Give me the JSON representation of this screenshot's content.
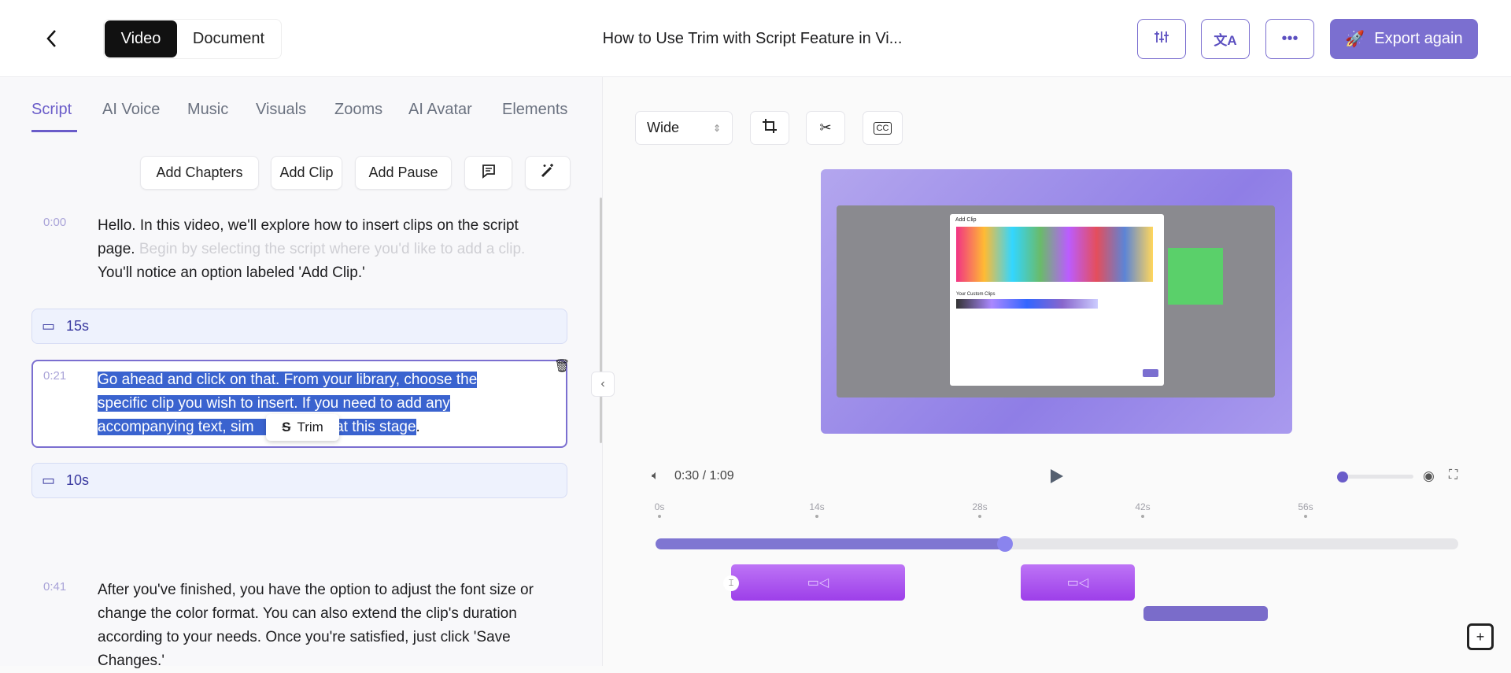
{
  "header": {
    "title": "How to Use Trim with Script Feature in Vi...",
    "mode_tabs": [
      "Video",
      "Document"
    ],
    "active_mode": "Video",
    "export_label": "Export again"
  },
  "tabs": [
    "Script",
    "AI Voice",
    "Music",
    "Visuals",
    "Zooms",
    "AI Avatar",
    "Elements"
  ],
  "active_tab": "Script",
  "actions": {
    "add_chapters": "Add Chapters",
    "add_clip": "Add Clip",
    "add_pause": "Add Pause"
  },
  "script": [
    {
      "time": "0:00",
      "text_a": "Hello. In this video, we'll explore how to insert clips on the script page.",
      "text_faded": "Begin by selecting the script where you'd like to add a clip.",
      "text_b": "You'll notice an option labeled 'Add Clip.'"
    },
    {
      "clip": "15s"
    },
    {
      "time": "0:21",
      "line1": "Go ahead and click on that. From your library, choose the",
      "line2": "specific clip you wish to insert. If you need to add any",
      "line3a": "accompanying text, sim",
      "line3b": "t at this stage",
      "line3c": "."
    },
    {
      "clip": "10s"
    },
    {
      "time": "0:41",
      "text": "After you've finished, you have the option to adjust the font size or change the color format. You can also extend the clip's duration according to your needs. Once you're satisfied, just click 'Save Changes.'"
    }
  ],
  "trim_popup": "Trim",
  "player": {
    "aspect": "Wide",
    "time": "0:30 / 1:09",
    "progress": 0.435,
    "ticks": [
      "0s",
      "14s",
      "28s",
      "42s",
      "56s"
    ]
  },
  "preview": {
    "dialog_title": "Add Clip",
    "custom_clips": "Your Custom Clips"
  },
  "colors": {
    "accent": "#7b6fd0",
    "clip": "#a855f7"
  }
}
